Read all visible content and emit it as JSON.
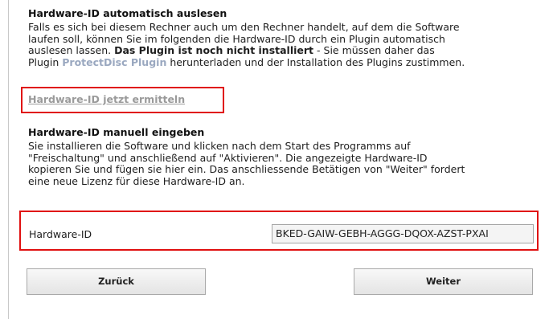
{
  "auto": {
    "heading": "Hardware-ID automatisch auslesen",
    "line1": "Falls es sich bei diesem Rechner auch um den Rechner handelt, auf dem die Software",
    "line2": "laufen soll, können Sie im folgenden die Hardware-ID durch ein Plugin automatisch",
    "line3_pre": "auslesen lassen. ",
    "line3_bold": "Das Plugin ist noch nicht installiert",
    "line3_post": " - Sie müssen daher das",
    "line4_pre": "Plugin ",
    "plugin_name": "ProtectDisc Plugin",
    "line4_post": " herunterladen und der Installation des Plugins zustimmen.",
    "link_label": "Hardware-ID jetzt ermitteln"
  },
  "manual": {
    "heading": "Hardware-ID manuell eingeben",
    "line1": "Sie installieren die Software und klicken nach dem Start des Programms auf",
    "line2": "\"Freischaltung\" und anschließend auf \"Aktivieren\". Die angezeigte Hardware-ID",
    "line3": "kopieren Sie und fügen sie hier ein. Das anschliessende Betätigen von \"Weiter\" fordert",
    "line4": "eine neue Lizenz für diese Hardware-ID an."
  },
  "hardware_id": {
    "label": "Hardware-ID",
    "value": "BKED-GAIW-GEBH-AGGG-DQOX-AZST-PXAI"
  },
  "buttons": {
    "back": "Zurück",
    "next": "Weiter"
  },
  "colors": {
    "highlight_border": "#e01010",
    "plugin_link": "#9aa8c0"
  }
}
